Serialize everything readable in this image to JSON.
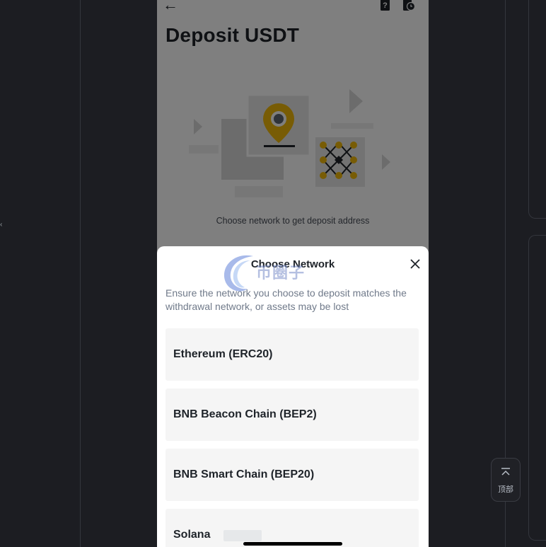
{
  "page": {
    "title": "Deposit USDT",
    "hint": "Choose network to get deposit address"
  },
  "sheet": {
    "title": "Choose Network",
    "description": "Ensure the network you choose to deposit matches the withdrawal network, or assets may be lost",
    "networks": [
      {
        "label": "Ethereum (ERC20)"
      },
      {
        "label": "BNB Beacon Chain (BEP2)"
      },
      {
        "label": "BNB Smart Chain (BEP20)"
      },
      {
        "label": "Solana"
      }
    ]
  },
  "watermark": {
    "text": "币圈子"
  },
  "side": {
    "top_button_label": "顶部"
  },
  "colors": {
    "accent": "#c99400",
    "background": "#1c1d22",
    "text": "#1e2329"
  },
  "icons": [
    "back-arrow-icon",
    "faq-icon",
    "history-icon",
    "close-icon",
    "scroll-to-top-icon"
  ]
}
